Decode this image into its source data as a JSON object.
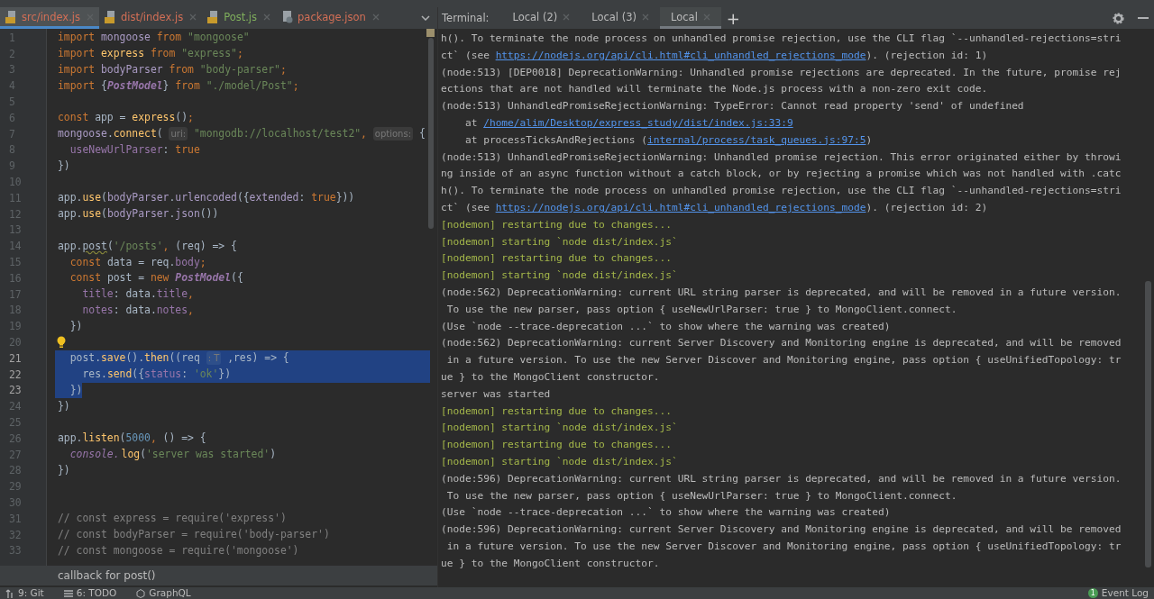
{
  "file_tabs": [
    {
      "label": "src/index.js",
      "color": "#d36f56",
      "selected": true
    },
    {
      "label": "dist/index.js",
      "color": "#d36f56",
      "selected": false
    },
    {
      "label": "Post.js",
      "color": "#7fae5c",
      "selected": false
    },
    {
      "label": "package.json",
      "color": "#d36f56",
      "selected": false
    }
  ],
  "editor": {
    "lines": [
      {
        "n": "1",
        "selected": false,
        "tokens": [
          {
            "kind": "kw",
            "text": "import "
          },
          {
            "kind": "gvar",
            "text": "mongoose "
          },
          {
            "kind": "kw",
            "text": "from "
          },
          {
            "kind": "str",
            "text": "\"mongoose\""
          }
        ]
      },
      {
        "n": "2",
        "selected": false,
        "tokens": [
          {
            "kind": "kw",
            "text": "import "
          },
          {
            "kind": "fn",
            "text": "express "
          },
          {
            "kind": "kw",
            "text": "from "
          },
          {
            "kind": "str",
            "text": "\"express\""
          },
          {
            "kind": "kw",
            "text": ";"
          }
        ]
      },
      {
        "n": "3",
        "selected": false,
        "tokens": [
          {
            "kind": "kw",
            "text": "import "
          },
          {
            "kind": "gvar",
            "text": "bodyParser "
          },
          {
            "kind": "kw",
            "text": "from "
          },
          {
            "kind": "str",
            "text": "\"body-parser\""
          },
          {
            "kind": "kw",
            "text": ";"
          }
        ]
      },
      {
        "n": "4",
        "selected": false,
        "tokens": [
          {
            "kind": "kw",
            "text": "import "
          },
          {
            "kind": "id",
            "text": "{"
          },
          {
            "kind": "cls",
            "text": "PostModel"
          },
          {
            "kind": "id",
            "text": "} "
          },
          {
            "kind": "kw",
            "text": "from "
          },
          {
            "kind": "str",
            "text": "\"./model/Post\""
          },
          {
            "kind": "kw",
            "text": ";"
          }
        ]
      },
      {
        "n": "5",
        "selected": false
      },
      {
        "n": "6",
        "selected": false,
        "tokens": [
          {
            "kind": "kw",
            "text": "const "
          },
          {
            "kind": "id",
            "text": "app = "
          },
          {
            "kind": "fn",
            "text": "express"
          },
          {
            "kind": "id",
            "text": "()"
          },
          {
            "kind": "kw",
            "text": ";"
          }
        ]
      },
      {
        "n": "7",
        "selected": false,
        "tokens": [
          {
            "kind": "gvar",
            "text": "mongoose"
          },
          {
            "kind": "id",
            "text": "."
          },
          {
            "kind": "fn",
            "text": "connect"
          },
          {
            "kind": "id",
            "text": "( "
          },
          {
            "kind": "hint",
            "text": "uri:"
          },
          {
            "kind": "str",
            "text": " \"mongodb://localhost/test2\""
          },
          {
            "kind": "kw",
            "text": ", "
          },
          {
            "kind": "hint",
            "text": "options:"
          },
          {
            "kind": "id",
            "text": " {"
          }
        ]
      },
      {
        "n": "8",
        "selected": false,
        "tokens": [
          {
            "kind": "prop",
            "text": "  useNewUrlParser"
          },
          {
            "kind": "id",
            "text": ": "
          },
          {
            "kind": "kw",
            "text": "true"
          }
        ]
      },
      {
        "n": "9",
        "selected": false,
        "tokens": [
          {
            "kind": "id",
            "text": "})"
          }
        ]
      },
      {
        "n": "10",
        "selected": false
      },
      {
        "n": "11",
        "selected": false,
        "tokens": [
          {
            "kind": "id",
            "text": "app."
          },
          {
            "kind": "fn",
            "text": "use"
          },
          {
            "kind": "id",
            "text": "("
          },
          {
            "kind": "gvar",
            "text": "bodyParser"
          },
          {
            "kind": "id",
            "text": "."
          },
          {
            "kind": "gvar",
            "text": "urlencoded"
          },
          {
            "kind": "id",
            "text": "({"
          },
          {
            "kind": "gvar",
            "text": "extended"
          },
          {
            "kind": "id",
            "text": ": "
          },
          {
            "kind": "kw",
            "text": "true"
          },
          {
            "kind": "id",
            "text": "}))"
          }
        ]
      },
      {
        "n": "12",
        "selected": false,
        "tokens": [
          {
            "kind": "id",
            "text": "app."
          },
          {
            "kind": "fn",
            "text": "use"
          },
          {
            "kind": "id",
            "text": "("
          },
          {
            "kind": "gvar",
            "text": "bodyParser"
          },
          {
            "kind": "id",
            "text": "."
          },
          {
            "kind": "gvar",
            "text": "json"
          },
          {
            "kind": "id",
            "text": "())"
          }
        ]
      },
      {
        "n": "13",
        "selected": false
      },
      {
        "n": "14",
        "selected": false,
        "tokens": [
          {
            "kind": "id",
            "text": "app."
          },
          {
            "kind": "warn",
            "text": "post"
          },
          {
            "kind": "id",
            "text": "("
          },
          {
            "kind": "str",
            "text": "'/posts'"
          },
          {
            "kind": "kw",
            "text": ", "
          },
          {
            "kind": "id",
            "text": "(req) => {"
          }
        ]
      },
      {
        "n": "15",
        "selected": false,
        "tokens": [
          {
            "kind": "kw",
            "text": "  const "
          },
          {
            "kind": "id",
            "text": "data = req."
          },
          {
            "kind": "prop",
            "text": "body"
          },
          {
            "kind": "kw",
            "text": ";"
          }
        ]
      },
      {
        "n": "16",
        "selected": false,
        "tokens": [
          {
            "kind": "kw",
            "text": "  const "
          },
          {
            "kind": "id",
            "text": "post = "
          },
          {
            "kind": "kw",
            "text": "new "
          },
          {
            "kind": "cls",
            "text": "PostModel"
          },
          {
            "kind": "id",
            "text": "({"
          }
        ]
      },
      {
        "n": "17",
        "selected": false,
        "tokens": [
          {
            "kind": "prop",
            "text": "    title"
          },
          {
            "kind": "id",
            "text": ": data."
          },
          {
            "kind": "prop",
            "text": "title"
          },
          {
            "kind": "kw",
            "text": ","
          }
        ]
      },
      {
        "n": "18",
        "selected": false,
        "tokens": [
          {
            "kind": "prop",
            "text": "    notes"
          },
          {
            "kind": "id",
            "text": ": data."
          },
          {
            "kind": "prop",
            "text": "notes"
          },
          {
            "kind": "kw",
            "text": ","
          }
        ]
      },
      {
        "n": "19",
        "selected": false,
        "tokens": [
          {
            "kind": "id",
            "text": "  })"
          }
        ]
      },
      {
        "n": "20",
        "selected": false,
        "bulb": true
      },
      {
        "n": "21",
        "selected": true,
        "tokens": [
          {
            "kind": "id",
            "text": "  post."
          },
          {
            "kind": "fn",
            "text": "save"
          },
          {
            "kind": "id",
            "text": "()."
          },
          {
            "kind": "fn",
            "text": "then"
          },
          {
            "kind": "id",
            "text": "((req "
          },
          {
            "kind": "hint",
            "text": ": T"
          },
          {
            "kind": "id",
            "text": " ,res) => {"
          }
        ]
      },
      {
        "n": "22",
        "selected": true,
        "tokens": [
          {
            "kind": "id",
            "text": "    res."
          },
          {
            "kind": "fn",
            "text": "send"
          },
          {
            "kind": "id",
            "text": "({"
          },
          {
            "kind": "prop",
            "text": "status"
          },
          {
            "kind": "id",
            "text": ": "
          },
          {
            "kind": "str",
            "text": "'ok'"
          },
          {
            "kind": "id",
            "text": "})"
          }
        ]
      },
      {
        "n": "23",
        "selected": true,
        "tokens": [
          {
            "kind": "id",
            "text": "  })"
          }
        ]
      },
      {
        "n": "24",
        "selected": false,
        "tokens": [
          {
            "kind": "id",
            "text": "})"
          }
        ]
      },
      {
        "n": "25",
        "selected": false
      },
      {
        "n": "26",
        "selected": false,
        "tokens": [
          {
            "kind": "id",
            "text": "app."
          },
          {
            "kind": "fn",
            "text": "listen"
          },
          {
            "kind": "id",
            "text": "("
          },
          {
            "kind": "num",
            "text": "5000"
          },
          {
            "kind": "kw",
            "text": ", "
          },
          {
            "kind": "id",
            "text": "() => {"
          }
        ]
      },
      {
        "n": "27",
        "selected": false,
        "tokens": [
          {
            "kind": "italic",
            "text": "  console."
          },
          {
            "kind": "fn",
            "text": "log"
          },
          {
            "kind": "id",
            "text": "("
          },
          {
            "kind": "str",
            "text": "'server was started'"
          },
          {
            "kind": "id",
            "text": ")"
          }
        ]
      },
      {
        "n": "28",
        "selected": false,
        "tokens": [
          {
            "kind": "id",
            "text": "})"
          }
        ]
      },
      {
        "n": "29",
        "selected": false
      },
      {
        "n": "30",
        "selected": false
      },
      {
        "n": "31",
        "selected": false,
        "tokens": [
          {
            "kind": "comment",
            "text": "// const express = require('express')"
          }
        ]
      },
      {
        "n": "32",
        "selected": false,
        "tokens": [
          {
            "kind": "comment",
            "text": "// const bodyParser = require('body-parser')"
          }
        ]
      },
      {
        "n": "33",
        "selected": false,
        "tokens": [
          {
            "kind": "comment",
            "text": "// const mongoose = require('mongoose')"
          }
        ]
      }
    ],
    "popup": "callback for post()"
  },
  "terminal": {
    "label": "Terminal:",
    "tabs": [
      {
        "label": "Local (2)",
        "selected": false
      },
      {
        "label": "Local (3)",
        "selected": false
      },
      {
        "label": "Local",
        "selected": true
      }
    ],
    "new_tab": "+",
    "lines": [
      {
        "kind": "plain",
        "parts": [
          {
            "text": "h(). To terminate the node process on unhandled promise rejection, use the CLI flag `--unhandled-rejections=stri"
          }
        ]
      },
      {
        "kind": "plain",
        "parts": [
          {
            "text": "ct` (see "
          },
          {
            "text": "https://nodejs.org/api/cli.html#cli_unhandled_rejections_mode",
            "link": true
          },
          {
            "text": "). (rejection id: 1)"
          }
        ]
      },
      {
        "kind": "plain",
        "parts": [
          {
            "text": "(node:513) [DEP0018] DeprecationWarning: Unhandled promise rejections are deprecated. In the future, promise rej"
          }
        ]
      },
      {
        "kind": "plain",
        "parts": [
          {
            "text": "ections that are not handled will terminate the Node.js process with a non-zero exit code."
          }
        ]
      },
      {
        "kind": "plain",
        "parts": [
          {
            "text": "(node:513) UnhandledPromiseRejectionWarning: TypeError: Cannot read property 'send' of undefined"
          }
        ]
      },
      {
        "kind": "plain",
        "parts": [
          {
            "text": "    at "
          },
          {
            "text": "/home/alim/Desktop/express_study/dist/index.js:33:9",
            "link": true
          }
        ]
      },
      {
        "kind": "plain",
        "parts": [
          {
            "text": "    at processTicksAndRejections ("
          },
          {
            "text": "internal/process/task_queues.js:97:5",
            "link": true
          },
          {
            "text": ")"
          }
        ]
      },
      {
        "kind": "plain",
        "parts": [
          {
            "text": "(node:513) UnhandledPromiseRejectionWarning: Unhandled promise rejection. This error originated either by throwi"
          }
        ]
      },
      {
        "kind": "plain",
        "parts": [
          {
            "text": "ng inside of an async function without a catch block, or by rejecting a promise which was not handled with .catc"
          }
        ]
      },
      {
        "kind": "plain",
        "parts": [
          {
            "text": "h(). To terminate the node process on unhandled promise rejection, use the CLI flag `--unhandled-rejections=stri"
          }
        ]
      },
      {
        "kind": "plain",
        "parts": [
          {
            "text": "ct` (see "
          },
          {
            "text": "https://nodejs.org/api/cli.html#cli_unhandled_rejections_mode",
            "link": true
          },
          {
            "text": "). (rejection id: 2)"
          }
        ]
      },
      {
        "kind": "nodemon",
        "parts": [
          {
            "text": "[nodemon] restarting due to changes..."
          }
        ]
      },
      {
        "kind": "nodemon",
        "parts": [
          {
            "text": "[nodemon] starting `node dist/index.js`"
          }
        ]
      },
      {
        "kind": "nodemon",
        "parts": [
          {
            "text": "[nodemon] restarting due to changes..."
          }
        ]
      },
      {
        "kind": "nodemon",
        "parts": [
          {
            "text": "[nodemon] starting `node dist/index.js`"
          }
        ]
      },
      {
        "kind": "plain",
        "parts": [
          {
            "text": "(node:562) DeprecationWarning: current URL string parser is deprecated, and will be removed in a future version."
          }
        ]
      },
      {
        "kind": "plain",
        "parts": [
          {
            "text": " To use the new parser, pass option { useNewUrlParser: true } to MongoClient.connect."
          }
        ]
      },
      {
        "kind": "plain",
        "parts": [
          {
            "text": "(Use `node --trace-deprecation ...` to show where the warning was created)"
          }
        ]
      },
      {
        "kind": "plain",
        "parts": [
          {
            "text": "(node:562) DeprecationWarning: current Server Discovery and Monitoring engine is deprecated, and will be removed"
          }
        ]
      },
      {
        "kind": "plain",
        "parts": [
          {
            "text": " in a future version. To use the new Server Discover and Monitoring engine, pass option { useUnifiedTopology: tr"
          }
        ]
      },
      {
        "kind": "plain",
        "parts": [
          {
            "text": "ue } to the MongoClient constructor."
          }
        ]
      },
      {
        "kind": "plain",
        "parts": [
          {
            "text": "server was started"
          }
        ]
      },
      {
        "kind": "nodemon",
        "parts": [
          {
            "text": "[nodemon] restarting due to changes..."
          }
        ]
      },
      {
        "kind": "nodemon",
        "parts": [
          {
            "text": "[nodemon] starting `node dist/index.js`"
          }
        ]
      },
      {
        "kind": "nodemon",
        "parts": [
          {
            "text": "[nodemon] restarting due to changes..."
          }
        ]
      },
      {
        "kind": "nodemon",
        "parts": [
          {
            "text": "[nodemon] starting `node dist/index.js`"
          }
        ]
      },
      {
        "kind": "plain",
        "parts": [
          {
            "text": "(node:596) DeprecationWarning: current URL string parser is deprecated, and will be removed in a future version."
          }
        ]
      },
      {
        "kind": "plain",
        "parts": [
          {
            "text": " To use the new parser, pass option { useNewUrlParser: true } to MongoClient.connect."
          }
        ]
      },
      {
        "kind": "plain",
        "parts": [
          {
            "text": "(Use `node --trace-deprecation ...` to show where the warning was created)"
          }
        ]
      },
      {
        "kind": "plain",
        "parts": [
          {
            "text": "(node:596) DeprecationWarning: current Server Discovery and Monitoring engine is deprecated, and will be removed"
          }
        ]
      },
      {
        "kind": "plain",
        "parts": [
          {
            "text": " in a future version. To use the new Server Discover and Monitoring engine, pass option { useUnifiedTopology: tr"
          }
        ]
      },
      {
        "kind": "plain",
        "parts": [
          {
            "text": "ue } to the MongoClient constructor."
          }
        ]
      }
    ]
  },
  "status_bar": {
    "items": [
      {
        "label": "9: Git"
      },
      {
        "label": "6: TODO"
      },
      {
        "label": "GraphQL"
      }
    ],
    "event_log": {
      "label": "Event Log",
      "count": "1"
    }
  }
}
